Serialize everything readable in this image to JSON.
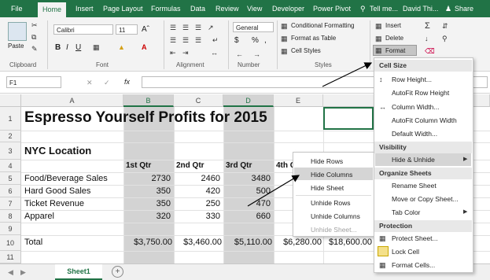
{
  "colors": {
    "brand": "#217346",
    "selected_column": "#d3d3d3"
  },
  "tabs": [
    "File",
    "Home",
    "Insert",
    "Page Layout",
    "Formulas",
    "Data",
    "Review",
    "View",
    "Developer",
    "Power Pivot",
    "Tell me...",
    "David Thi...",
    "Share"
  ],
  "ribbon": {
    "clipboard": {
      "paste": "Paste",
      "label": "Clipboard"
    },
    "font": {
      "name": "Calibri",
      "size": "11",
      "label": "Font",
      "bold": "B",
      "italic": "I",
      "underline": "U"
    },
    "alignment": {
      "label": "Alignment"
    },
    "number": {
      "format": "General",
      "label": "Number",
      "currency": "$",
      "percent": "%",
      "comma": ","
    },
    "styles": {
      "conditional": "Conditional Formatting",
      "table": "Format as Table",
      "cell": "Cell Styles",
      "label": "Styles"
    },
    "cells": {
      "insert": "Insert",
      "delete": "Delete",
      "format": "Format"
    }
  },
  "formula_bar": {
    "name_box": "F1",
    "fx": "fx",
    "value": ""
  },
  "columns": [
    "A",
    "B",
    "C",
    "D",
    "E",
    "F"
  ],
  "rows": [
    "1",
    "2",
    "3",
    "4",
    "5",
    "6",
    "7",
    "8",
    "9",
    "10",
    "11"
  ],
  "sheet": {
    "title": "Espresso Yourself  Profits for 2015",
    "location": "NYC Location",
    "headers": [
      "1st Qtr",
      "2nd Qtr",
      "3rd Qtr",
      "4th Q"
    ],
    "rows": [
      {
        "label": "Food/Beverage Sales",
        "values": [
          "2730",
          "2460",
          "3480"
        ]
      },
      {
        "label": "Hard Good Sales",
        "values": [
          "350",
          "420",
          "500"
        ]
      },
      {
        "label": "Ticket Revenue",
        "values": [
          "350",
          "250",
          "470"
        ]
      },
      {
        "label": "Apparel",
        "values": [
          "320",
          "330",
          "660"
        ]
      }
    ],
    "total_label": "Total",
    "totals": [
      "$3,750.00",
      "$3,460.00",
      "$5,110.00",
      "$6,280.00",
      "$18,600.00"
    ],
    "tab": "Sheet1",
    "add_sheet": "+"
  },
  "format_menu": {
    "sections": {
      "cell_size": "Cell Size",
      "visibility": "Visibility",
      "organize": "Organize Sheets",
      "protection": "Protection"
    },
    "items": [
      "Row Height...",
      "AutoFit Row Height",
      "Column Width...",
      "AutoFit Column Width",
      "Default Width...",
      "Hide & Unhide",
      "Rename Sheet",
      "Move or Copy Sheet...",
      "Tab Color",
      "Protect Sheet...",
      "Lock Cell",
      "Format Cells..."
    ]
  },
  "hide_menu": {
    "items": [
      "Hide Rows",
      "Hide Columns",
      "Hide Sheet",
      "Unhide Rows",
      "Unhide Columns",
      "Unhide Sheet..."
    ]
  }
}
